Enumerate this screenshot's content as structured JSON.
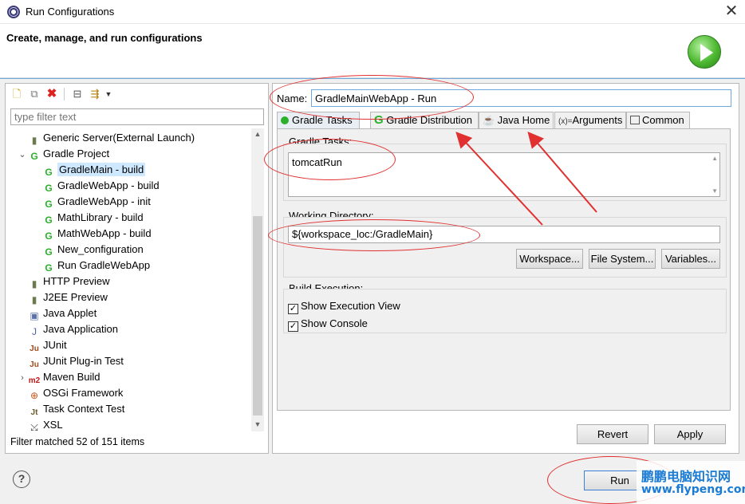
{
  "window": {
    "title": "Run Configurations",
    "close_glyph": "✕"
  },
  "header": {
    "title": "Create, manage, and run configurations",
    "icon": "run-green-icon"
  },
  "left": {
    "filter_placeholder": "type filter text",
    "tree": [
      {
        "label": "Generic Server(External Launch)",
        "icon": "server-icon",
        "depth": 1,
        "expander": ""
      },
      {
        "label": "Gradle Project",
        "icon": "gradle-icon",
        "depth": 1,
        "expander": "⌄"
      },
      {
        "label": "GradleMain - build",
        "icon": "gradle-icon",
        "depth": 2,
        "expander": "",
        "selected": true
      },
      {
        "label": "GradleWebApp - build",
        "icon": "gradle-icon",
        "depth": 2,
        "expander": ""
      },
      {
        "label": "GradleWebApp - init",
        "icon": "gradle-icon",
        "depth": 2,
        "expander": ""
      },
      {
        "label": "MathLibrary - build",
        "icon": "gradle-icon",
        "depth": 2,
        "expander": ""
      },
      {
        "label": "MathWebApp - build",
        "icon": "gradle-icon",
        "depth": 2,
        "expander": ""
      },
      {
        "label": "New_configuration",
        "icon": "gradle-icon",
        "depth": 2,
        "expander": ""
      },
      {
        "label": "Run GradleWebApp",
        "icon": "gradle-icon",
        "depth": 2,
        "expander": ""
      },
      {
        "label": "HTTP Preview",
        "icon": "server-icon",
        "depth": 1,
        "expander": ""
      },
      {
        "label": "J2EE Preview",
        "icon": "server-icon",
        "depth": 1,
        "expander": ""
      },
      {
        "label": "Java Applet",
        "icon": "java-applet-icon",
        "depth": 1,
        "expander": ""
      },
      {
        "label": "Java Application",
        "icon": "java-app-icon",
        "depth": 1,
        "expander": ""
      },
      {
        "label": "JUnit",
        "icon": "junit-icon",
        "depth": 1,
        "expander": ""
      },
      {
        "label": "JUnit Plug-in Test",
        "icon": "junit-plugin-icon",
        "depth": 1,
        "expander": ""
      },
      {
        "label": "Maven Build",
        "icon": "maven-icon",
        "depth": 1,
        "expander": "›"
      },
      {
        "label": "OSGi Framework",
        "icon": "osgi-icon",
        "depth": 1,
        "expander": ""
      },
      {
        "label": "Task Context Test",
        "icon": "task-context-icon",
        "depth": 1,
        "expander": ""
      },
      {
        "label": "XSL",
        "icon": "xsl-icon",
        "depth": 1,
        "expander": ""
      }
    ],
    "status": "Filter matched 52 of 151 items"
  },
  "right": {
    "name_label": "Name:",
    "name_value": "GradleMainWebApp - Run",
    "tabs": [
      {
        "label": "Gradle Tasks",
        "icon": "green-dot-icon",
        "active": true
      },
      {
        "label": "Gradle Distribution",
        "icon": "gradle-icon"
      },
      {
        "label": "Java Home",
        "icon": "java-home-icon"
      },
      {
        "label": "Arguments",
        "icon": "arguments-icon"
      },
      {
        "label": "Common",
        "icon": "common-icon"
      }
    ],
    "gradle_tasks_label": "Gradle Tasks:",
    "gradle_tasks_value": "tomcatRun",
    "working_dir_label": "Working Directory:",
    "working_dir_value": "${workspace_loc:/GradleMain}",
    "workspace_btn": "Workspace...",
    "filesystem_btn": "File System...",
    "variables_btn": "Variables...",
    "build_exec_label": "Build Execution:",
    "show_exec_view": "Show Execution View",
    "show_console": "Show Console",
    "revert_btn": "Revert",
    "apply_btn": "Apply"
  },
  "footer": {
    "run_btn": "Run",
    "help_glyph": "?"
  },
  "watermark": {
    "line1": "鹏鹏电脑知识网",
    "line2": "www.flypeng.com"
  },
  "colors": {
    "annotation": "#e03030",
    "selection": "#cde8ff",
    "gradle_green": "#2bb02b",
    "watermark": "#1a7bd4"
  }
}
